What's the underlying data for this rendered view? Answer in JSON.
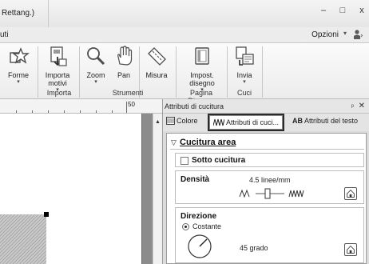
{
  "window": {
    "title_partial": "Rettang.)",
    "controls": {
      "minimize": "–",
      "maximize": "□",
      "close": "x"
    }
  },
  "ribbon_tabs": {
    "partial_tab": "uti",
    "options_label": "Opzioni",
    "options_caret": "▾"
  },
  "ribbon": {
    "buttons": [
      {
        "label": "Forme",
        "caret": "▾",
        "icon": "shapes-icon"
      },
      {
        "label": "Importa",
        "label2": "motivi",
        "caret": "▾",
        "icon": "import-icon"
      },
      {
        "label": "Zoom",
        "caret": "▾",
        "icon": "zoom-icon"
      },
      {
        "label": "Pan",
        "icon": "pan-hand-icon"
      },
      {
        "label": "Misura",
        "icon": "measure-ruler-icon"
      },
      {
        "label": "Impost.",
        "label2": "disegno",
        "caret": "▾",
        "icon": "design-settings-icon"
      },
      {
        "label": "Invia",
        "caret": "▾",
        "icon": "send-icon"
      }
    ],
    "groups": [
      "Importa",
      "Strumenti",
      "Pagina Disegno",
      "Cuci"
    ]
  },
  "ruler": {
    "label": "50"
  },
  "panel": {
    "title": "Attributi di cucitura",
    "pin": "ᵖ",
    "close": "✕",
    "tabs": {
      "color": "Colore",
      "stitch": "Attributi di cuci...",
      "text": "Attributi del testo",
      "text_icon": "AB"
    },
    "section_title": "Cucitura area",
    "underlay_label": "Sotto cucitura",
    "density": {
      "label": "Densità",
      "value": "4.5 linee/mm"
    },
    "direction": {
      "label": "Direzione",
      "option": "Costante",
      "value": "45 grado"
    }
  }
}
